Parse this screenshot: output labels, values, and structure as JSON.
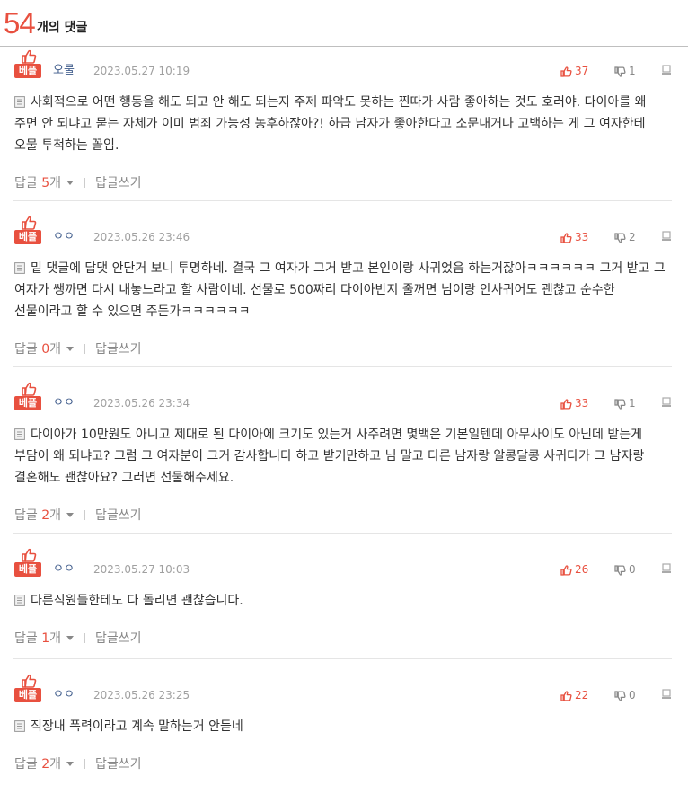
{
  "header": {
    "count": "54",
    "label": "개의 댓글"
  },
  "colors": {
    "accent": "#e8503f",
    "nickname": "#3d5a8a",
    "muted": "#a0a0a0",
    "separator": "#e5e5e5"
  },
  "icons": {
    "best": "thumbs-up-icon",
    "upvote": "thumbs-up-icon",
    "downvote": "thumbs-down-icon",
    "report": "report-icon",
    "comment": "document-icon",
    "reply_toggle": "caret-down-icon"
  },
  "comments": [
    {
      "badge": "베플",
      "nickname": "오물",
      "date": "2023.05.27 10:19",
      "up": "37",
      "down": "1",
      "text": "사회적으로 어떤 행동을 해도 되고 안 해도 되는지 주제 파악도 못하는 찐따가 사람 좋아하는 것도 호러야. 다이아를 왜 주면 안 되냐고 묻는 자체가 이미 범죄 가능성 농후하잖아?! 하급 남자가 좋아한다고 소문내거나 고백하는 게 그 여자한테 오물 투척하는 꼴임.",
      "reply_label": "답글",
      "reply_count": "5",
      "reply_unit": "개",
      "write_reply": "답글쓰기"
    },
    {
      "badge": "베플",
      "nickname": "ㅇㅇ",
      "date": "2023.05.26 23:46",
      "up": "33",
      "down": "2",
      "text": "밑 댓글에 답댓 안단거 보니 투명하네. 결국 그 여자가 그거 받고 본인이랑 사귀었음 하는거잖아ㅋㅋㅋㅋㅋㅋ 그거 받고 그 여자가 쌩까면 다시 내놓느라고 할 사람이네. 선물로 500짜리 다이아반지 줄꺼면 님이랑 안사귀어도 괜찮고 순수한 선물이라고 할 수 있으면 주든가ㅋㅋㅋㅋㅋㅋ",
      "reply_label": "답글",
      "reply_count": "0",
      "reply_unit": "개",
      "write_reply": "답글쓰기"
    },
    {
      "badge": "베플",
      "nickname": "ㅇㅇ",
      "date": "2023.05.26 23:34",
      "up": "33",
      "down": "1",
      "text": "다이아가 10만원도 아니고 제대로 된 다이아에 크기도 있는거 사주려면 몇백은 기본일텐데 아무사이도 아닌데 받는게 부담이 왜 되냐고? 그럼 그 여자분이 그거 감사합니다 하고 받기만하고 님 말고 다른 남자랑 알콩달콩 사귀다가 그 남자랑 결혼해도 괜찮아요? 그러면 선물해주세요.",
      "reply_label": "답글",
      "reply_count": "2",
      "reply_unit": "개",
      "write_reply": "답글쓰기"
    },
    {
      "badge": "베플",
      "nickname": "ㅇㅇ",
      "date": "2023.05.27 10:03",
      "up": "26",
      "down": "0",
      "text": "다른직원들한테도 다 돌리면 괜찮습니다.",
      "reply_label": "답글",
      "reply_count": "1",
      "reply_unit": "개",
      "write_reply": "답글쓰기"
    },
    {
      "badge": "베플",
      "nickname": "ㅇㅇ",
      "date": "2023.05.26 23:25",
      "up": "22",
      "down": "0",
      "text": "직장내 폭력이라고 계속 말하는거 안듣네",
      "reply_label": "답글",
      "reply_count": "2",
      "reply_unit": "개",
      "write_reply": "답글쓰기"
    }
  ]
}
